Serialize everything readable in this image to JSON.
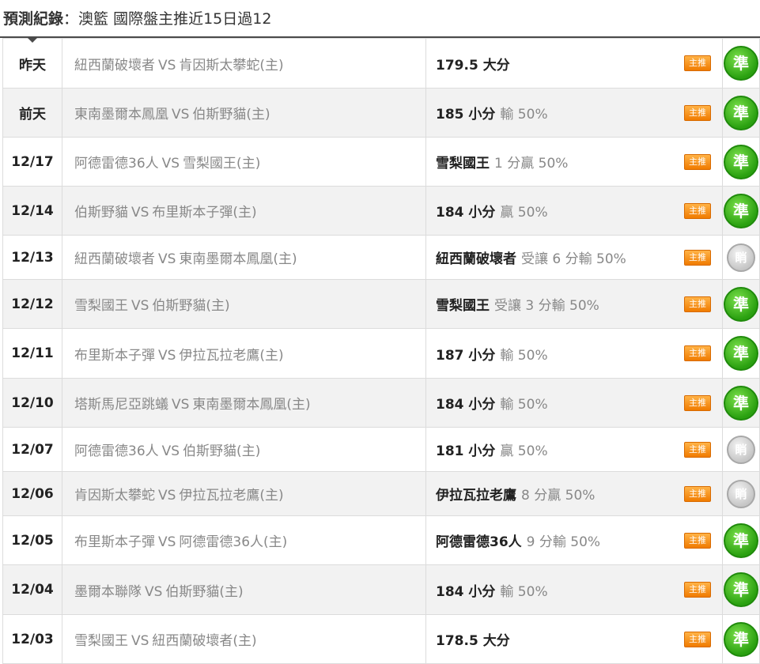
{
  "header": {
    "title_bold": "預測紀錄",
    "title_sep": "：",
    "title_text": "澳籃 國際盤主推近15日過12"
  },
  "vs_label": "VS",
  "tag_label": "主推",
  "rows": [
    {
      "date": "昨天",
      "home": "紐西蘭破壞者",
      "away": "肯因斯太攀蛇(主)",
      "pick": "179.5 大分",
      "detail": "",
      "result": "準"
    },
    {
      "date": "前天",
      "home": "東南墨爾本鳳凰",
      "away": "伯斯野貓(主)",
      "pick": "185 小分",
      "detail": "輸 50%",
      "result": "準"
    },
    {
      "date": "12/17",
      "home": "阿德雷德36人",
      "away": "雪梨國王(主)",
      "pick": "雪梨國王",
      "detail": "1 分贏 50%",
      "result": "準"
    },
    {
      "date": "12/14",
      "home": "伯斯野貓",
      "away": "布里斯本子彈(主)",
      "pick": "184 小分",
      "detail": "贏 50%",
      "result": "準"
    },
    {
      "date": "12/13",
      "home": "紐西蘭破壞者",
      "away": "東南墨爾本鳳凰(主)",
      "pick": "紐西蘭破壞者",
      "detail": "受讓 6 分輸 50%",
      "result": "睄"
    },
    {
      "date": "12/12",
      "home": "雪梨國王",
      "away": "伯斯野貓(主)",
      "pick": "雪梨國王",
      "detail": "受讓 3 分輸 50%",
      "result": "準"
    },
    {
      "date": "12/11",
      "home": "布里斯本子彈",
      "away": "伊拉瓦拉老鷹(主)",
      "pick": "187 小分",
      "detail": "輸 50%",
      "result": "準"
    },
    {
      "date": "12/10",
      "home": "塔斯馬尼亞跳蟻",
      "away": "東南墨爾本鳳凰(主)",
      "pick": "184 小分",
      "detail": "輸 50%",
      "result": "準"
    },
    {
      "date": "12/07",
      "home": "阿德雷德36人",
      "away": "伯斯野貓(主)",
      "pick": "181 小分",
      "detail": "贏 50%",
      "result": "睄"
    },
    {
      "date": "12/06",
      "home": "肯因斯太攀蛇",
      "away": "伊拉瓦拉老鷹(主)",
      "pick": "伊拉瓦拉老鷹",
      "detail": "8 分贏 50%",
      "result": "睄"
    },
    {
      "date": "12/05",
      "home": "布里斯本子彈",
      "away": "阿德雷德36人(主)",
      "pick": "阿德雷德36人",
      "detail": "9 分輸 50%",
      "result": "準"
    },
    {
      "date": "12/04",
      "home": "墨爾本聯隊",
      "away": "伯斯野貓(主)",
      "pick": "184 小分",
      "detail": "輸 50%",
      "result": "準"
    },
    {
      "date": "12/03",
      "home": "雪梨國王",
      "away": "紐西蘭破壞者(主)",
      "pick": "178.5 大分",
      "detail": "",
      "result": "準"
    }
  ]
}
